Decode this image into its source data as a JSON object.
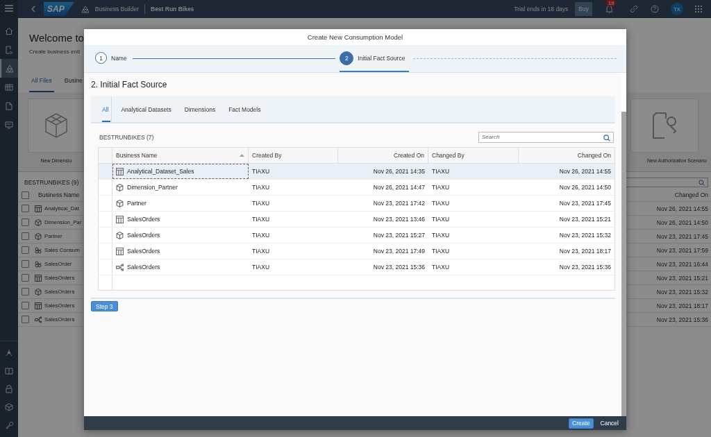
{
  "shell": {
    "logo": "SAP",
    "app": "Business Builder",
    "space": "Best Run Bikes",
    "trial": "Trial ends in 18 days",
    "buy": "Buy",
    "notifications": "19",
    "avatar": "TX"
  },
  "sidebar": {
    "items": [
      {
        "kind": "home",
        "selected": false
      },
      {
        "kind": "search",
        "selected": false
      },
      {
        "kind": "builder",
        "selected": true
      },
      {
        "kind": "table",
        "selected": false
      },
      {
        "kind": "file",
        "selected": false
      },
      {
        "kind": "monitor",
        "selected": false
      }
    ],
    "bottom_items": [
      {
        "kind": "network",
        "selected": false
      },
      {
        "kind": "book",
        "selected": false
      },
      {
        "kind": "lock",
        "selected": false
      },
      {
        "kind": "cube",
        "selected": false
      },
      {
        "kind": "wrench",
        "selected": false
      }
    ]
  },
  "page": {
    "title": "Welcome to",
    "subtitle": "Create business enti",
    "tabs": [
      {
        "label": "All Files",
        "selected": true
      },
      {
        "label": "Busine",
        "selected": false
      }
    ],
    "tiles": [
      {
        "kind": "dimension",
        "label": "New Dimensio"
      },
      {
        "kind": "authorization",
        "label": "New Authorization Scenario"
      }
    ],
    "table": {
      "title": "BESTRUNBIKES (9)",
      "all_checked": false,
      "columns": [
        "Business Name",
        "Changed On"
      ],
      "rows": [
        {
          "kind": "dataset",
          "checked": false,
          "name": "Analytical_Dat",
          "changed_on": "Nov 26, 2021 14:55"
        },
        {
          "kind": "dimension",
          "checked": false,
          "name": "Dimension_Par",
          "changed_on": "Nov 26, 2021 14:50"
        },
        {
          "kind": "dimension",
          "checked": false,
          "name": "Partner",
          "changed_on": "Nov 23, 2021 17:45"
        },
        {
          "kind": "consumption",
          "checked": false,
          "name": "Sales Consum",
          "changed_on": "Nov 23, 2021 17:59"
        },
        {
          "kind": "consumption",
          "checked": false,
          "name": "SalesOrder",
          "changed_on": "Nov 23, 2021 16:44"
        },
        {
          "kind": "dataset",
          "checked": false,
          "name": "SalesOrders",
          "changed_on": "Nov 23, 2021 15:21"
        },
        {
          "kind": "dimension",
          "checked": false,
          "name": "SalesOrders",
          "changed_on": "Nov 23, 2021 15:32"
        },
        {
          "kind": "dataset",
          "checked": false,
          "name": "SalesOrders",
          "changed_on": "Nov 23, 2021 18:17"
        },
        {
          "kind": "flow",
          "checked": false,
          "name": "SalesOrders",
          "changed_on": "Nov 23, 2021 15:36"
        }
      ]
    }
  },
  "dialog": {
    "title": "Create New Consumption Model",
    "steps": [
      {
        "number": "1",
        "label": "Name",
        "selected": false
      },
      {
        "number": "2",
        "label": "Initial Fact Source",
        "selected": true
      }
    ],
    "heading": "2. Initial Fact Source",
    "tabs": [
      {
        "label": "All",
        "selected": true
      },
      {
        "label": "Analytical Datasets",
        "selected": false
      },
      {
        "label": "Dimensions",
        "selected": false
      },
      {
        "label": "Fact Models",
        "selected": false
      }
    ],
    "list_title": "BESTRUNBIKES (7)",
    "search": {
      "placeholder": "Search"
    },
    "columns": [
      "Business Name",
      "Created By",
      "Created On",
      "Changed By",
      "Changed On"
    ],
    "rows": [
      {
        "kind": "dataset",
        "name": "Analytical_Dataset_Sales",
        "created_by": "TIAXU",
        "created_on": "Nov 26, 2021 14:35",
        "changed_by": "TIAXU",
        "changed_on": "Nov 26, 2021 14:55",
        "selected": true
      },
      {
        "kind": "dimension",
        "name": "Dimension_Partner",
        "created_by": "TIAXU",
        "created_on": "Nov 26, 2021 14:47",
        "changed_by": "TIAXU",
        "changed_on": "Nov 26, 2021 14:50",
        "selected": false
      },
      {
        "kind": "dimension",
        "name": "Partner",
        "created_by": "TIAXU",
        "created_on": "Nov 23, 2021 17:42",
        "changed_by": "TIAXU",
        "changed_on": "Nov 23, 2021 17:45",
        "selected": false
      },
      {
        "kind": "dataset",
        "name": "SalesOrders",
        "created_by": "TIAXU",
        "created_on": "Nov 23, 2021 13:46",
        "changed_by": "TIAXU",
        "changed_on": "Nov 23, 2021 15:21",
        "selected": false
      },
      {
        "kind": "dimension",
        "name": "SalesOrders",
        "created_by": "TIAXU",
        "created_on": "Nov 23, 2021 15:27",
        "changed_by": "TIAXU",
        "changed_on": "Nov 23, 2021 15:32",
        "selected": false
      },
      {
        "kind": "dataset",
        "name": "SalesOrders",
        "created_by": "TIAXU",
        "created_on": "Nov 23, 2021 17:49",
        "changed_by": "TIAXU",
        "changed_on": "Nov 23, 2021 18:17",
        "selected": false
      },
      {
        "kind": "flow",
        "name": "SalesOrders",
        "created_by": "TIAXU",
        "created_on": "Nov 23, 2021 15:36",
        "changed_by": "TIAXU",
        "changed_on": "Nov 23, 2021 15:36",
        "selected": false
      }
    ],
    "step_button": "Step 3",
    "buttons": [
      {
        "label": "Create",
        "kind": "primary"
      },
      {
        "label": "Cancel",
        "kind": "plain"
      }
    ]
  }
}
